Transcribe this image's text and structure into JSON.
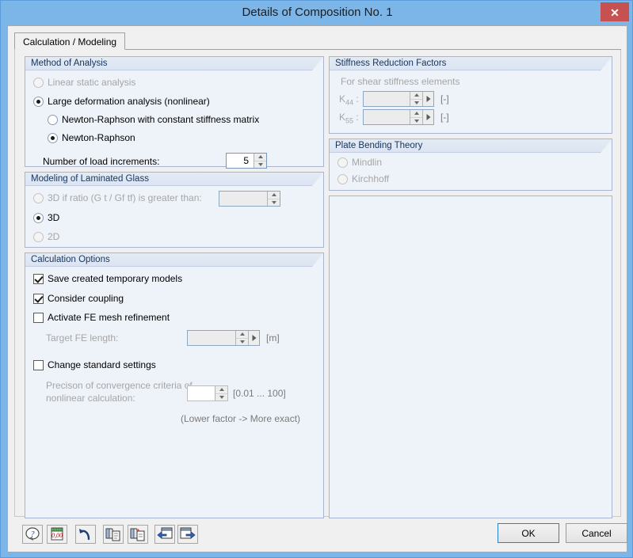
{
  "window": {
    "title": "Details of Composition No. 1",
    "close_label": "✕",
    "accent": "#7cb5e8",
    "close_color": "#c75050"
  },
  "tabs": [
    {
      "label": "Calculation / Modeling",
      "active": true
    }
  ],
  "method_of_analysis": {
    "title": "Method of Analysis",
    "options": [
      {
        "label": "Linear static analysis",
        "selected": false,
        "disabled": true
      },
      {
        "label": "Large deformation analysis (nonlinear)",
        "selected": true,
        "disabled": false
      }
    ],
    "sub_options": [
      {
        "label": "Newton-Raphson with constant stiffness matrix",
        "selected": false,
        "disabled": false
      },
      {
        "label": "Newton-Raphson",
        "selected": true,
        "disabled": false
      }
    ],
    "load_increments_label": "Number of load increments:",
    "load_increments_value": "5"
  },
  "modeling_laminated_glass": {
    "title": "Modeling of Laminated Glass",
    "ratio_option_label": "3D if ratio (G t / Gf tf) is greater than:",
    "ratio_value": "",
    "options": [
      {
        "label": "3D",
        "selected": true,
        "disabled": false
      },
      {
        "label": "2D",
        "selected": false,
        "disabled": true
      }
    ]
  },
  "calculation_options": {
    "title": "Calculation Options",
    "checkboxes": [
      {
        "label": "Save created temporary models",
        "checked": true,
        "disabled": false
      },
      {
        "label": "Consider coupling",
        "checked": true,
        "disabled": false
      },
      {
        "label": "Activate FE mesh refinement",
        "checked": false,
        "disabled": false
      },
      {
        "label": "Change standard settings",
        "checked": false,
        "disabled": false
      }
    ],
    "target_fe_length_label": "Target FE length:",
    "target_fe_length_value": "",
    "target_fe_length_unit": "[m]",
    "precision_label_line1": "Precison of convergence criteria of",
    "precision_label_line2": "nonlinear calculation:",
    "precision_value": "",
    "precision_range": "[0.01 ... 100]",
    "precision_hint": "(Lower factor -> More exact)"
  },
  "stiffness_reduction": {
    "title": "Stiffness Reduction Factors",
    "subtitle": "For shear stiffness elements",
    "fields": [
      {
        "label_base": "K",
        "label_sub": "44",
        "value": "",
        "unit": "[-]"
      },
      {
        "label_base": "K",
        "label_sub": "55",
        "value": "",
        "unit": "[-]"
      }
    ]
  },
  "plate_bending_theory": {
    "title": "Plate Bending Theory",
    "options": [
      {
        "label": "Mindlin",
        "selected": false,
        "disabled": true
      },
      {
        "label": "Kirchhoff",
        "selected": false,
        "disabled": true
      }
    ]
  },
  "toolbar": {
    "buttons": [
      {
        "icon": "help-icon"
      },
      {
        "icon": "units-icon"
      },
      {
        "icon": "undo-icon"
      },
      {
        "icon": "copy-icon"
      },
      {
        "icon": "paste-icon"
      },
      {
        "icon": "import-icon"
      },
      {
        "icon": "export-icon"
      }
    ]
  },
  "actions": {
    "ok_label": "OK",
    "cancel_label": "Cancel"
  }
}
